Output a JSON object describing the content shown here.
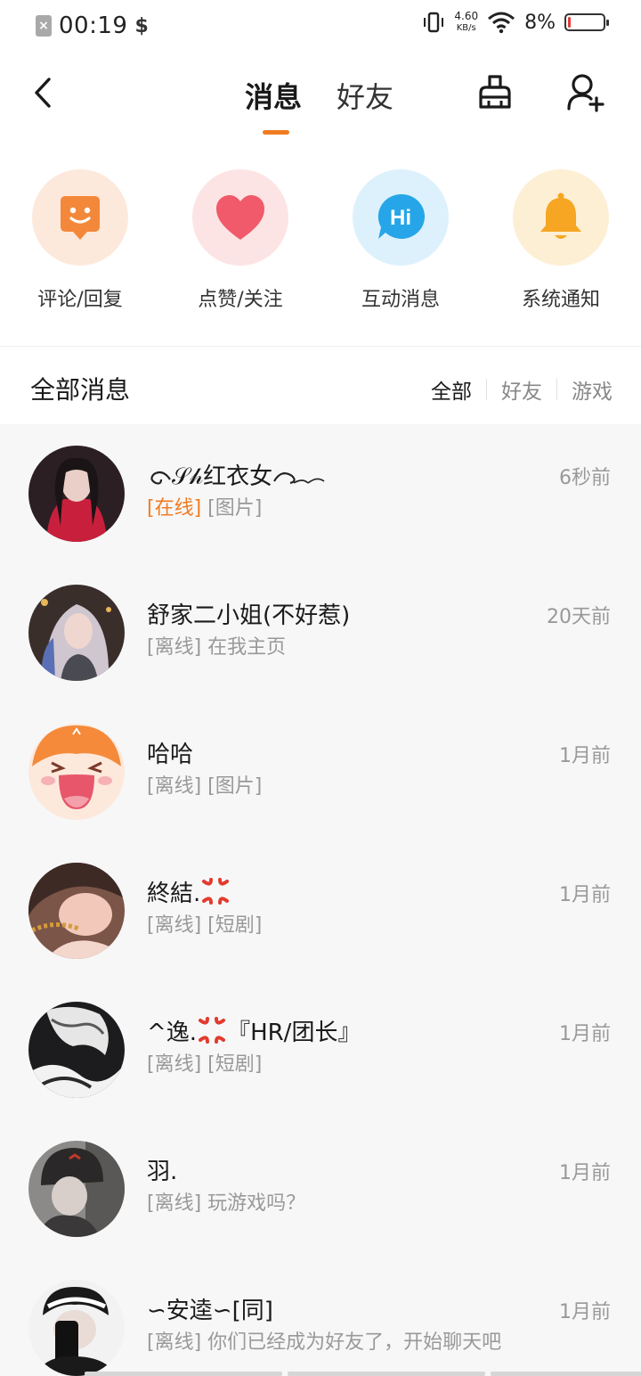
{
  "status_bar": {
    "time": "00:19",
    "net_speed_value": "4.60",
    "net_speed_unit": "KB/s",
    "battery_pct": "8%",
    "battery_level": 0.08
  },
  "header": {
    "tabs": [
      {
        "label": "消息",
        "active": true
      },
      {
        "label": "好友",
        "active": false
      }
    ],
    "accent": "#f07c22"
  },
  "quick_entries": [
    {
      "label": "评论/回复",
      "icon": "comment-smile-icon",
      "bg": "#fde9dc",
      "color": "#f4883a"
    },
    {
      "label": "点赞/关注",
      "icon": "heart-icon",
      "bg": "#fde4e4",
      "color": "#f05a6a"
    },
    {
      "label": "互动消息",
      "icon": "hi-bubble-icon",
      "bg": "#ddf1fc",
      "color": "#26a6e8"
    },
    {
      "label": "系统通知",
      "icon": "bell-icon",
      "bg": "#fdefd4",
      "color": "#f6a623"
    }
  ],
  "filter": {
    "title": "全部消息",
    "options": [
      "全部",
      "好友",
      "游戏"
    ],
    "active": "全部"
  },
  "messages": [
    {
      "name": "𝒮𝒽红衣女",
      "time": "6秒前",
      "status": "[在线]",
      "online": true,
      "preview": "[图片]"
    },
    {
      "name": "舒家二小姐(不好惹)",
      "time": "20天前",
      "status": "[离线]",
      "online": false,
      "preview": "在我主页"
    },
    {
      "name": "哈哈",
      "time": "1月前",
      "status": "[离线]",
      "online": false,
      "preview": "[图片]"
    },
    {
      "name": "終結.",
      "time": "1月前",
      "status": "[离线]",
      "online": false,
      "preview": "[短剧]"
    },
    {
      "name": "^逸.",
      "name_suffix": "『HR/团长』",
      "time": "1月前",
      "status": "[离线]",
      "online": false,
      "preview": "[短剧]"
    },
    {
      "name": "羽.",
      "time": "1月前",
      "status": "[离线]",
      "online": false,
      "preview": "玩游戏吗？"
    },
    {
      "name": "∽安逵∽[同]",
      "time": "1月前",
      "status": "[离线]",
      "online": false,
      "preview": "你们已经成为好友了，开始聊天吧"
    }
  ]
}
